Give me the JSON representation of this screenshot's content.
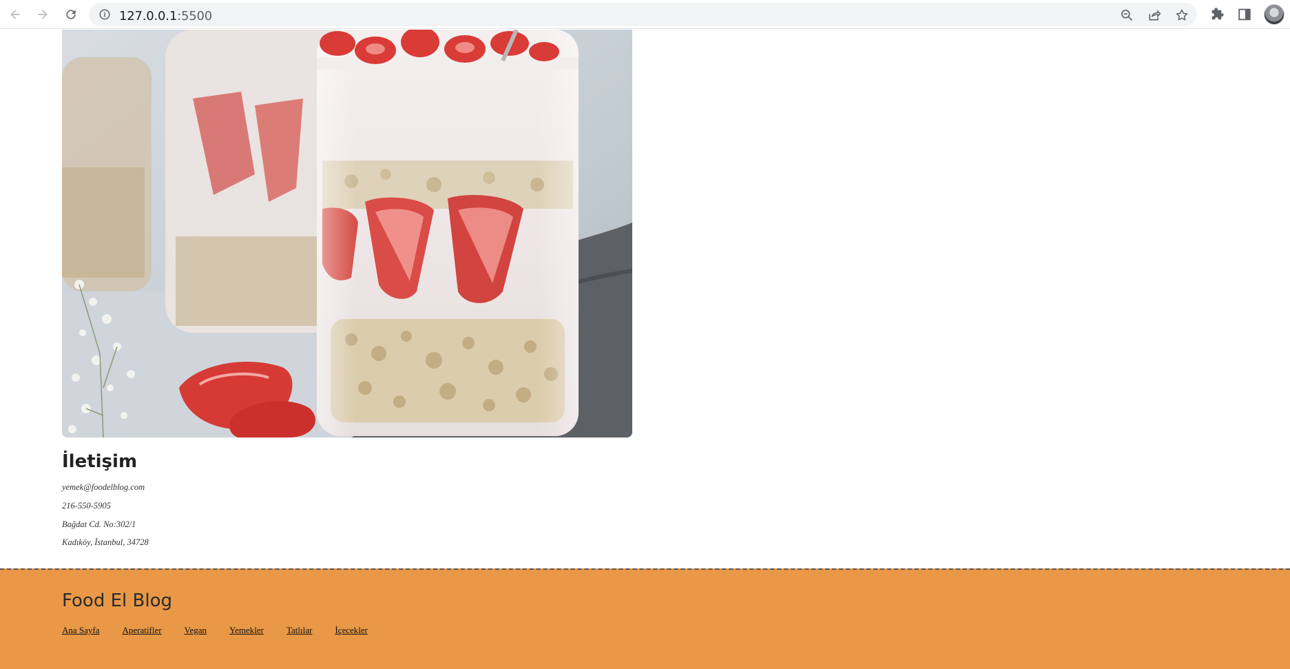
{
  "browser": {
    "url_host": "127.0.0.1",
    "url_port": ":5500"
  },
  "contact": {
    "title": "İletişim",
    "email": "yemek@foodelblog.com",
    "phone": "216-550-5905",
    "address_line1": "Bağdat Cd. No:302/1",
    "address_line2": "Kadıköy, İstanbul, 34728"
  },
  "footer": {
    "title": "Food El Blog",
    "links": [
      "Ana Sayfa",
      "Aperatifler",
      "Vegan",
      "Yemekler",
      "Tatlılar",
      "İçecekler"
    ]
  },
  "icons": {
    "back": "arrow-left-icon",
    "forward": "arrow-right-icon",
    "reload": "reload-icon",
    "info": "info-icon",
    "zoom": "zoom-out-icon",
    "share": "share-icon",
    "bookmark": "star-icon",
    "extensions": "puzzle-icon",
    "sidepanel": "side-panel-icon"
  },
  "colors": {
    "footer_bg": "#e89846",
    "strawberry": "#d9423e"
  }
}
